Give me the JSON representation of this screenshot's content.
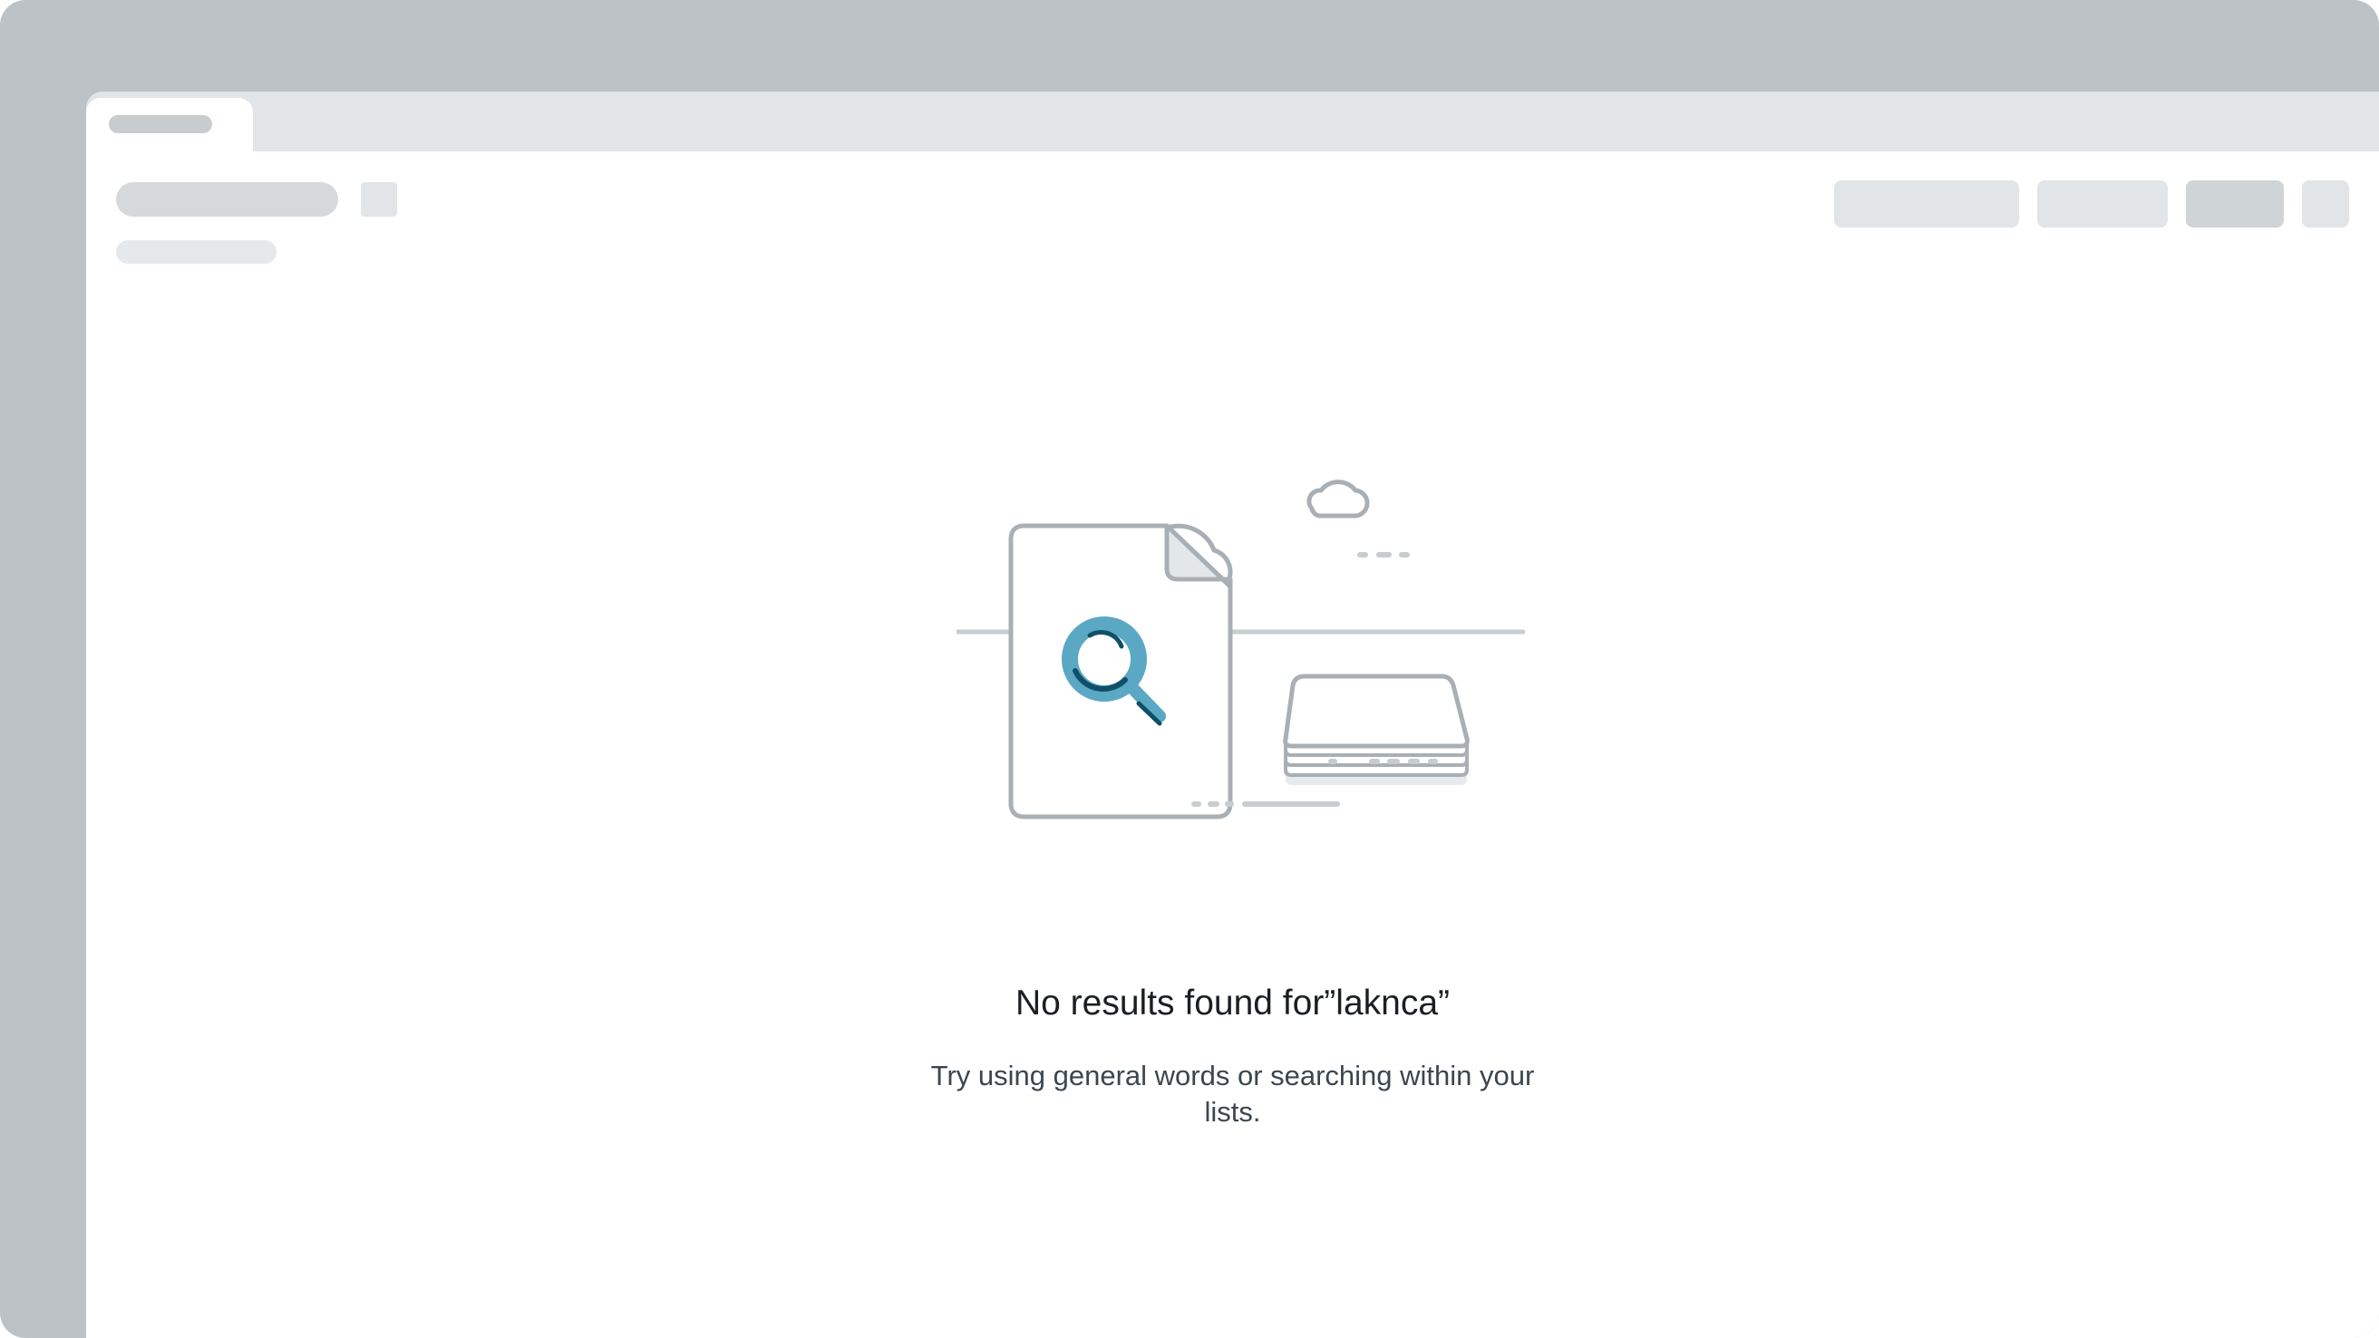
{
  "empty_state": {
    "title": "No results found for”laknca”",
    "description_line1": "Try using general words or searching within your",
    "description_line2": "lists.",
    "illustration_icon": "magnifier-document-icon",
    "accent_color": "#5aa8c4",
    "accent_dark_color": "#0f4f68"
  }
}
